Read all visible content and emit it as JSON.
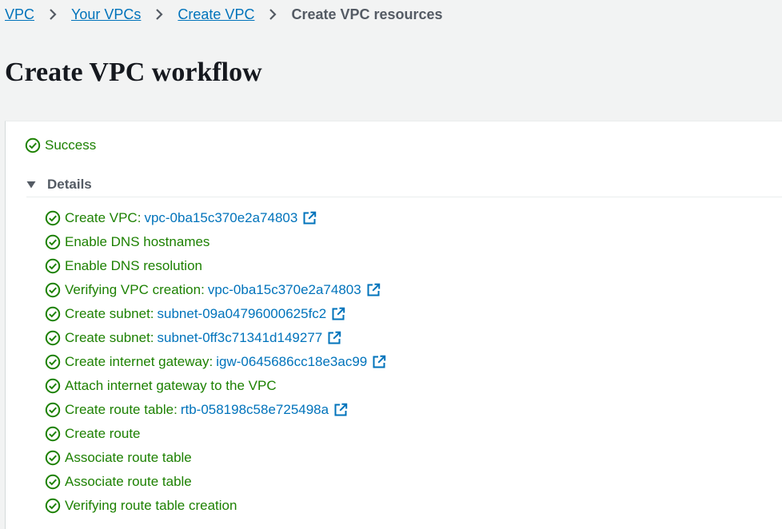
{
  "breadcrumb": {
    "items": [
      "VPC",
      "Your VPCs",
      "Create VPC"
    ],
    "current": "Create VPC resources"
  },
  "page_title": "Create VPC workflow",
  "status": {
    "label": "Success",
    "color": "#1d8102"
  },
  "details": {
    "label": "Details",
    "expanded": true,
    "steps": [
      {
        "label": "Create VPC:",
        "link": "vpc-0ba15c370e2a74803"
      },
      {
        "label": "Enable DNS hostnames",
        "link": null
      },
      {
        "label": "Enable DNS resolution",
        "link": null
      },
      {
        "label": "Verifying VPC creation:",
        "link": "vpc-0ba15c370e2a74803"
      },
      {
        "label": "Create subnet:",
        "link": "subnet-09a04796000625fc2"
      },
      {
        "label": "Create subnet:",
        "link": "subnet-0ff3c71341d149277"
      },
      {
        "label": "Create internet gateway:",
        "link": "igw-0645686cc18e3ac99"
      },
      {
        "label": "Attach internet gateway to the VPC",
        "link": null
      },
      {
        "label": "Create route table:",
        "link": "rtb-058198c58e725498a"
      },
      {
        "label": "Create route",
        "link": null
      },
      {
        "label": "Associate route table",
        "link": null
      },
      {
        "label": "Associate route table",
        "link": null
      },
      {
        "label": "Verifying route table creation",
        "link": null
      }
    ]
  },
  "icons": {
    "step_status": "check-circle-icon",
    "external": "external-link-icon",
    "separator": "chevron-right-icon",
    "toggle": "caret-down-icon"
  },
  "colors": {
    "link": "#0073bb",
    "success": "#1d8102",
    "background": "#f2f3f3"
  }
}
